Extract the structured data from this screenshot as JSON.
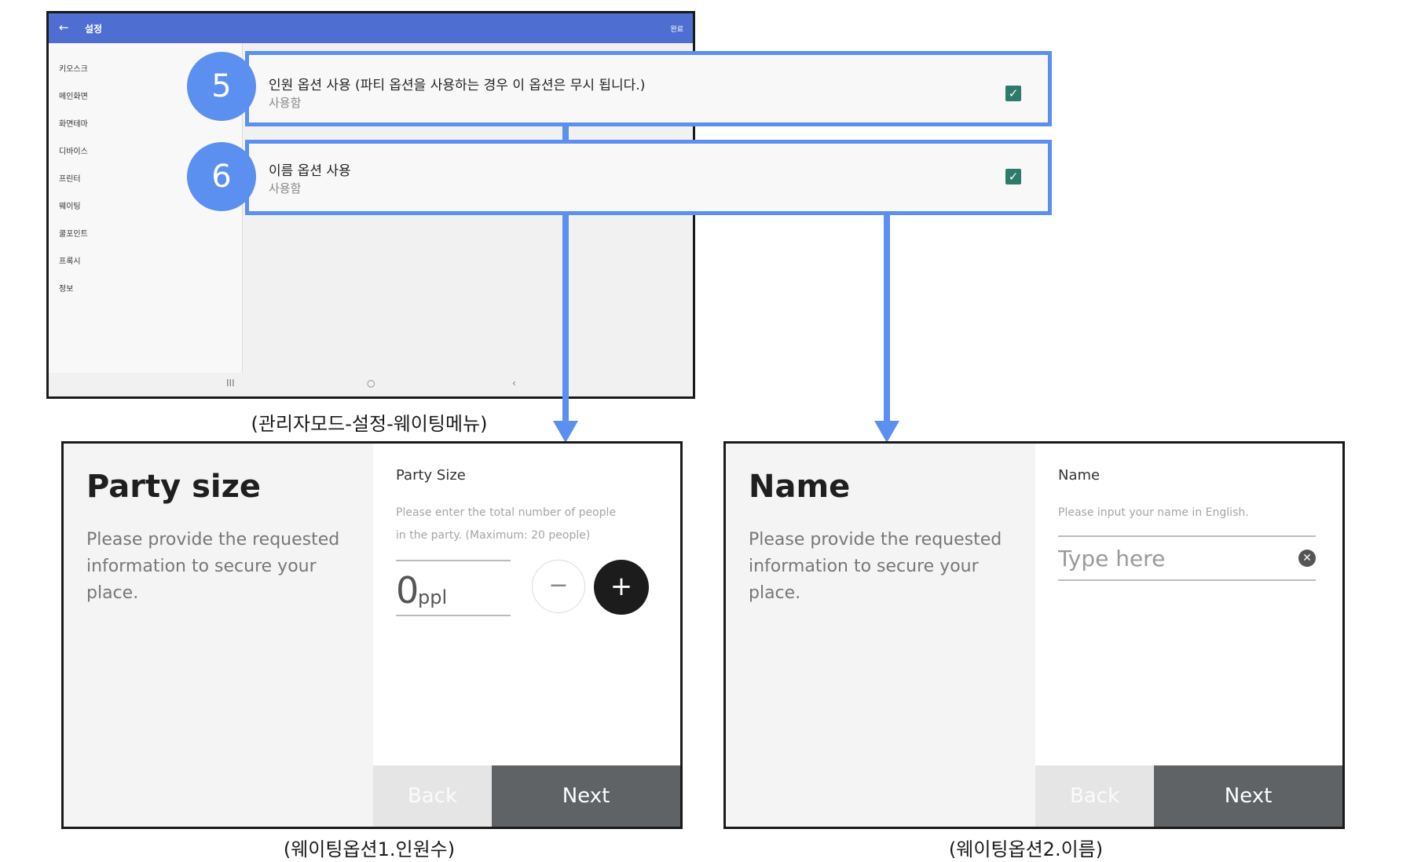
{
  "admin_screen": {
    "back_icon": "←",
    "title": "설정",
    "done_label": "완료",
    "sidebar_items": [
      "키오스크",
      "메인화면",
      "화면테마",
      "디바이스",
      "프린터",
      "웨이팅",
      "쿨포인트",
      "프록시",
      "정보"
    ],
    "nav": {
      "recent": "III",
      "home": "○",
      "back": "‹"
    }
  },
  "options": [
    {
      "number": "5",
      "label": "인원 옵션 사용 (파티 옵션을 사용하는 경우 이 옵션은 무시 됩니다.)",
      "status": "사용함",
      "checked": true
    },
    {
      "number": "6",
      "label": "이름 옵션 사용",
      "status": "사용함",
      "checked": true
    }
  ],
  "captions": {
    "admin": "(관리자모드-설정-웨이팅메뉴)",
    "option1": "(웨이팅옵션1.인원수)",
    "option2": "(웨이팅옵션2.이름)"
  },
  "party_panel": {
    "heading": "Party size",
    "description": "Please provide the requested information to secure your place.",
    "field_title": "Party Size",
    "hint": "Please enter the total number of people in the party. (Maximum: 20 people)",
    "count": "0",
    "unit": "ppl",
    "minus": "−",
    "plus": "+",
    "back_label": "Back",
    "next_label": "Next"
  },
  "name_panel": {
    "heading": "Name",
    "description": "Please provide the requested information to secure your place.",
    "field_title": "Name",
    "hint": "Please input your name in English.",
    "placeholder": "Type here",
    "value": "",
    "clear": "✕",
    "back_label": "Back",
    "next_label": "Next"
  },
  "colors": {
    "accent_blue": "#5b8ff0",
    "appbar_blue": "#4f6ed1",
    "check_green": "#2f7a6a",
    "next_button": "#5f6366"
  },
  "icons": [
    "back-arrow-icon",
    "checkbox-checked-icon",
    "minus-icon",
    "plus-icon",
    "clear-icon"
  ]
}
